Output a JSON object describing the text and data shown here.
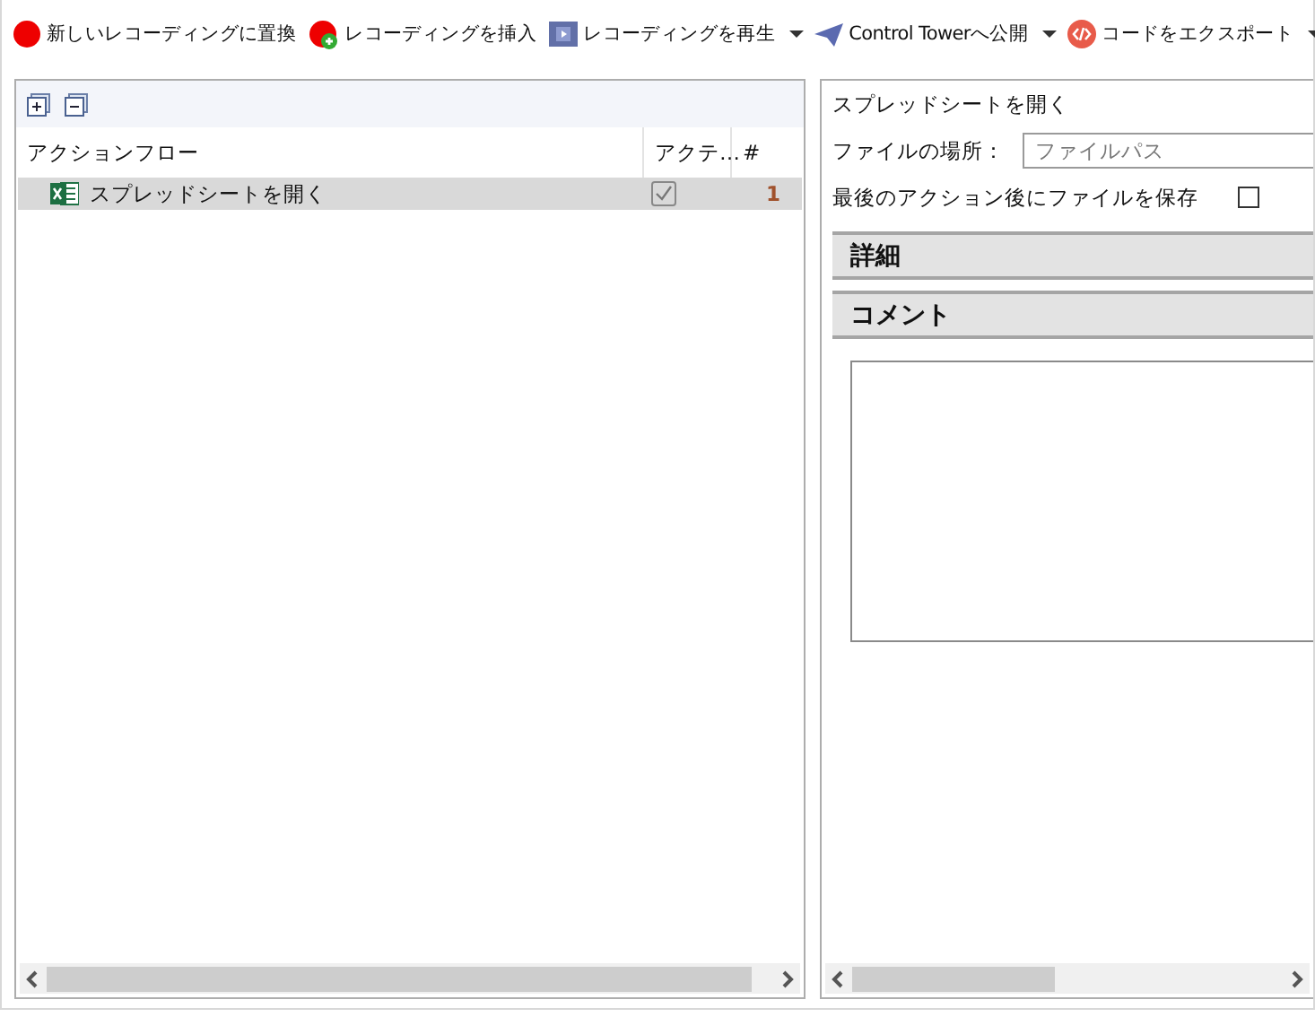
{
  "toolbar": [
    {
      "kind": "record",
      "label": "新しいレコーディングに置換",
      "dropdown": false
    },
    {
      "kind": "record-add",
      "label": "レコーディングを挿入",
      "dropdown": false
    },
    {
      "kind": "play",
      "label": "レコーディングを再生",
      "dropdown": true
    },
    {
      "kind": "publish",
      "label": "Control Towerへ公開",
      "dropdown": true
    },
    {
      "kind": "code",
      "label": "コードをエクスポート",
      "dropdown": true
    }
  ],
  "flow": {
    "columns": [
      "アクションフロー",
      "アクテ…",
      "#"
    ],
    "rows": [
      {
        "action": "スプレッドシートを開く",
        "active": true,
        "number": "1",
        "selected": true
      }
    ]
  },
  "properties": {
    "title": "スプレッドシートを開く",
    "file_label": "ファイルの場所：",
    "file_placeholder": "ファイルパス",
    "save_label": "最後のアクション後にファイルを保存",
    "save_checked": false,
    "sections": [
      "詳細",
      "コメント"
    ]
  }
}
